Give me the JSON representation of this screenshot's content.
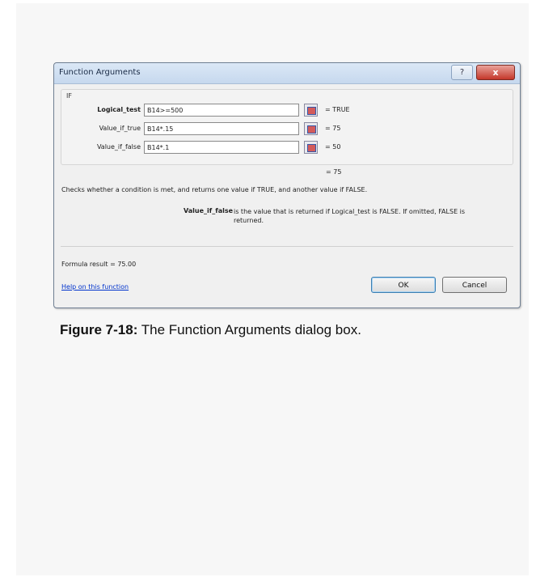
{
  "dialog": {
    "title": "Function Arguments",
    "help_button": "?",
    "close_button": "x",
    "function_name": "IF",
    "arguments": [
      {
        "label": "Logical_test",
        "value": "B14>=500",
        "result": "= TRUE"
      },
      {
        "label": "Value_if_true",
        "value": "B14*.15",
        "result": "= 75"
      },
      {
        "label": "Value_if_false",
        "value": "B14*.1",
        "result": "= 50"
      }
    ],
    "total_result": "= 75",
    "description": "Checks whether a condition is met, and returns one value if TRUE, and another value if FALSE.",
    "param_name": "Value_if_false",
    "param_description": "is the value that is returned if Logical_test is FALSE. If omitted, FALSE is returned.",
    "formula_result": "Formula result =   75.00",
    "help_link": "Help on this function",
    "ok_label": "OK",
    "cancel_label": "Cancel"
  },
  "caption": {
    "prefix": "Figure 7-18:",
    "text": " The Function Arguments dialog box."
  }
}
